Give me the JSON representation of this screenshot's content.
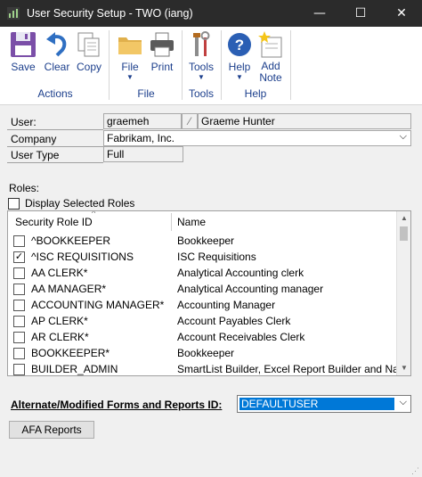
{
  "window": {
    "title": "User Security Setup  -  TWO (iang)",
    "minimize": "—",
    "maximize": "☐",
    "close": "✕"
  },
  "ribbon": {
    "buttons": {
      "save": "Save",
      "clear": "Clear",
      "copy": "Copy",
      "file": "File",
      "print": "Print",
      "tools": "Tools",
      "help": "Help",
      "add_note": "Add\nNote"
    },
    "groups": {
      "actions": "Actions",
      "file": "File",
      "tools": "Tools",
      "help": "Help"
    }
  },
  "form": {
    "user_label": "User:",
    "user_id": "graemeh",
    "user_name": "Graeme Hunter",
    "company_label": "Company",
    "company_value": "Fabrikam, Inc.",
    "user_type_label": "User Type",
    "user_type_value": "Full",
    "roles_label": "Roles:",
    "display_selected_roles": "Display Selected Roles",
    "display_selected_checked": false
  },
  "roles_table": {
    "columns": [
      "Security Role ID",
      "Name"
    ],
    "rows": [
      {
        "id": "^BOOKKEEPER",
        "name": "Bookkeeper",
        "checked": false
      },
      {
        "id": "^ISC REQUISITIONS",
        "name": "ISC Requisitions",
        "checked": true
      },
      {
        "id": "AA CLERK*",
        "name": "Analytical Accounting clerk",
        "checked": false
      },
      {
        "id": "AA MANAGER*",
        "name": "Analytical Accounting manager",
        "checked": false
      },
      {
        "id": "ACCOUNTING MANAGER*",
        "name": "Accounting Manager",
        "checked": false
      },
      {
        "id": "AP CLERK*",
        "name": "Account Payables Clerk",
        "checked": false
      },
      {
        "id": "AR CLERK*",
        "name": "Account Receivables Clerk",
        "checked": false
      },
      {
        "id": "BOOKKEEPER*",
        "name": "Bookkeeper",
        "checked": false
      },
      {
        "id": "BUILDER_ADMIN",
        "name": "SmartList Builder, Excel Report Builder and Naviga",
        "checked": false
      }
    ]
  },
  "alternate": {
    "label": "Alternate/Modified Forms and Reports ID:",
    "value": "DEFAULTUSER"
  },
  "afa_button": "AFA Reports",
  "colors": {
    "titlebar": "#2b2b2b",
    "ribbon_text": "#1c3f8c",
    "selection": "#0078d7"
  }
}
